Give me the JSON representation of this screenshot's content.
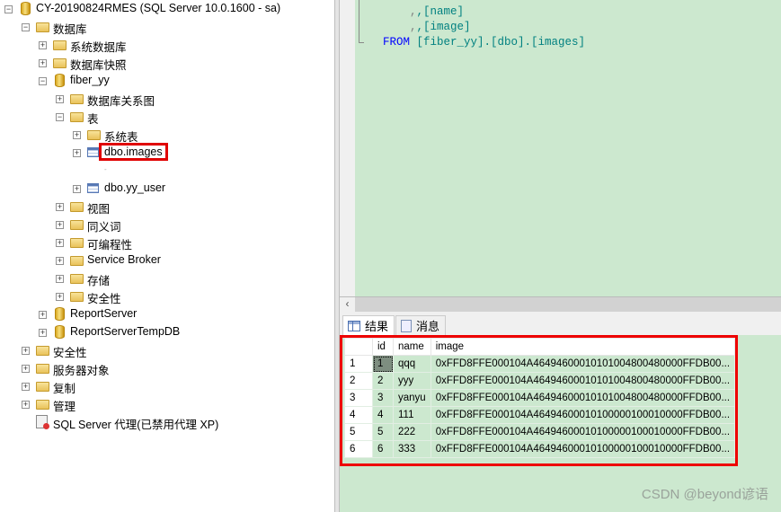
{
  "tree": [
    {
      "label": "CY-20190824RMES (SQL Server 10.0.1600 - sa)",
      "level": 0,
      "icon": "server-icon",
      "expander": "minus"
    },
    {
      "label": "数据库",
      "level": 1,
      "icon": "folder-icon",
      "expander": "minus"
    },
    {
      "label": "系统数据库",
      "level": 2,
      "icon": "folder-icon",
      "expander": "plus"
    },
    {
      "label": "数据库快照",
      "level": 2,
      "icon": "folder-icon",
      "expander": "plus"
    },
    {
      "label": "fiber_yy",
      "level": 2,
      "icon": "database-icon",
      "expander": "minus"
    },
    {
      "label": "数据库关系图",
      "level": 3,
      "icon": "folder-icon",
      "expander": "plus"
    },
    {
      "label": "表",
      "level": 3,
      "icon": "folder-icon",
      "expander": "minus"
    },
    {
      "label": "系统表",
      "level": 4,
      "icon": "folder-icon",
      "expander": "plus"
    },
    {
      "label": "dbo.images",
      "level": 4,
      "icon": "table-icon",
      "expander": "plus",
      "highlighted": true
    },
    {
      "label": "",
      "level": 4,
      "icon": "",
      "expander": ""
    },
    {
      "label": "dbo.yy_user",
      "level": 4,
      "icon": "table-icon",
      "expander": "plus"
    },
    {
      "label": "视图",
      "level": 3,
      "icon": "folder-icon",
      "expander": "plus"
    },
    {
      "label": "同义词",
      "level": 3,
      "icon": "folder-icon",
      "expander": "plus"
    },
    {
      "label": "可编程性",
      "level": 3,
      "icon": "folder-icon",
      "expander": "plus"
    },
    {
      "label": "Service Broker",
      "level": 3,
      "icon": "folder-icon",
      "expander": "plus"
    },
    {
      "label": "存储",
      "level": 3,
      "icon": "folder-icon",
      "expander": "plus"
    },
    {
      "label": "安全性",
      "level": 3,
      "icon": "folder-icon",
      "expander": "plus"
    },
    {
      "label": "ReportServer",
      "level": 2,
      "icon": "database-icon",
      "expander": "plus"
    },
    {
      "label": "ReportServerTempDB",
      "level": 2,
      "icon": "database-icon",
      "expander": "plus"
    },
    {
      "label": "安全性",
      "level": 1,
      "icon": "folder-icon",
      "expander": "plus"
    },
    {
      "label": "服务器对象",
      "level": 1,
      "icon": "folder-icon",
      "expander": "plus"
    },
    {
      "label": "复制",
      "level": 1,
      "icon": "folder-icon",
      "expander": "plus"
    },
    {
      "label": "管理",
      "level": 1,
      "icon": "folder-icon",
      "expander": "plus"
    },
    {
      "label": "SQL Server 代理(已禁用代理 XP)",
      "level": 1,
      "icon": "agent-icon",
      "expander": ""
    }
  ],
  "editor": {
    "line1": ",[name]",
    "line2": ",[image]",
    "from_kw": "FROM",
    "from_obj": "[fiber_yy].[dbo].[images]"
  },
  "results": {
    "tabs": [
      {
        "label": "结果",
        "icon": "grid-icon",
        "active": true
      },
      {
        "label": "消息",
        "icon": "messages-icon"
      }
    ],
    "columns": [
      "",
      "id",
      "name",
      "image"
    ],
    "rows": [
      [
        "1",
        "1",
        "qqq",
        "0xFFD8FFE000104A46494600010101004800480000FFDB00..."
      ],
      [
        "2",
        "2",
        "yyy",
        "0xFFD8FFE000104A46494600010101004800480000FFDB00..."
      ],
      [
        "3",
        "3",
        "yanyu",
        "0xFFD8FFE000104A46494600010101004800480000FFDB00..."
      ],
      [
        "4",
        "4",
        "111",
        "0xFFD8FFE000104A46494600010100000100010000FFDB00..."
      ],
      [
        "5",
        "5",
        "222",
        "0xFFD8FFE000104A46494600010100000100010000FFDB00..."
      ],
      [
        "6",
        "6",
        "333",
        "0xFFD8FFE000104A46494600010100000100010000FFDB00..."
      ]
    ]
  },
  "watermark": "CSDN @beyond谚语",
  "colors": {
    "editor_bg": "#cce8cf",
    "highlight": "#ee0000",
    "keyword": "#0000ff",
    "identifier": "#008080"
  }
}
